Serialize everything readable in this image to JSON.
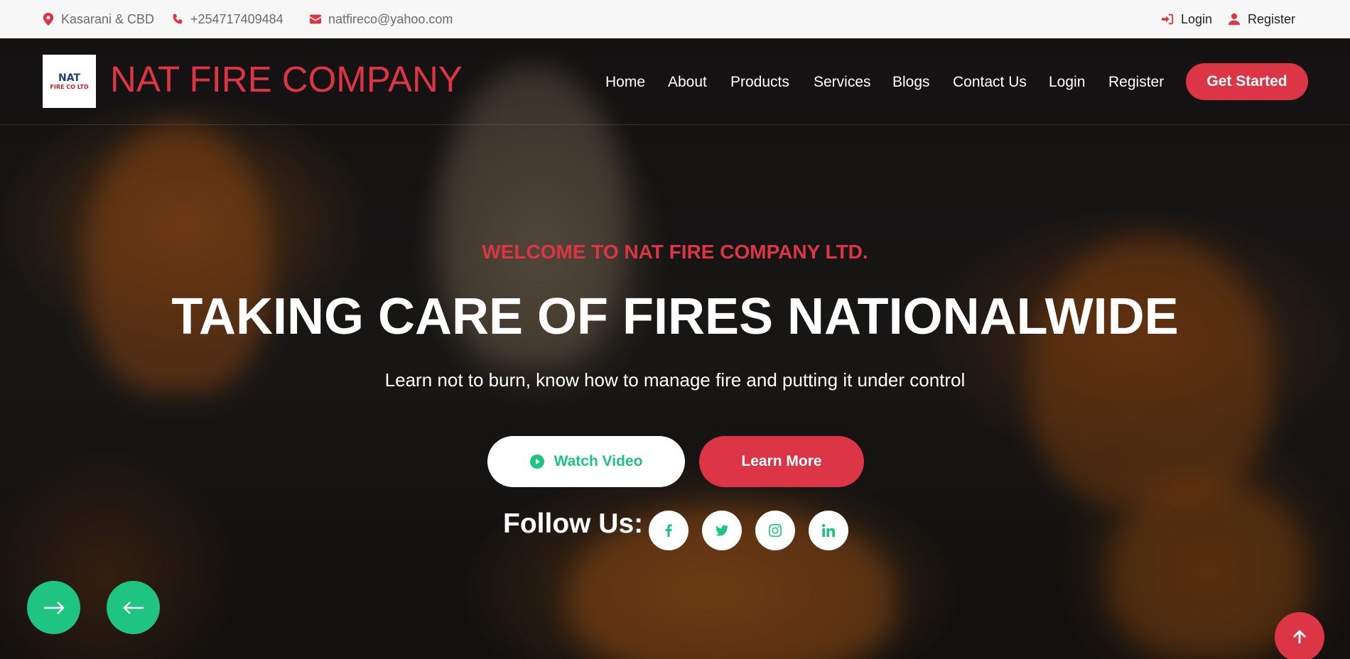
{
  "topbar": {
    "location": "Kasarani & CBD",
    "phone": "+254717409484",
    "email": "natfireco@yahoo.com",
    "login": "Login",
    "register": "Register",
    "accent_color": "#dc3545"
  },
  "header": {
    "logo_text_top": "NAT",
    "logo_text_bottom": "FIRE CO LTD",
    "brand": "NAT FIRE COMPANY",
    "nav": [
      "Home",
      "About",
      "Products",
      "Services",
      "Blogs",
      "Contact Us",
      "Login",
      "Register"
    ],
    "cta": "Get Started"
  },
  "hero": {
    "welcome": "WELCOME TO NAT FIRE COMPANY LTD.",
    "headline": "TAKING CARE OF FIRES NATIONALWIDE",
    "subline": "Learn not to burn, know how to manage fire and putting it under control",
    "watch_video": "Watch Video",
    "learn_more": "Learn More",
    "follow_us": "Follow Us:",
    "social_icons": [
      "facebook-icon",
      "twitter-icon",
      "instagram-icon",
      "linkedin-icon"
    ],
    "secondary_color": "#1ec47f"
  }
}
